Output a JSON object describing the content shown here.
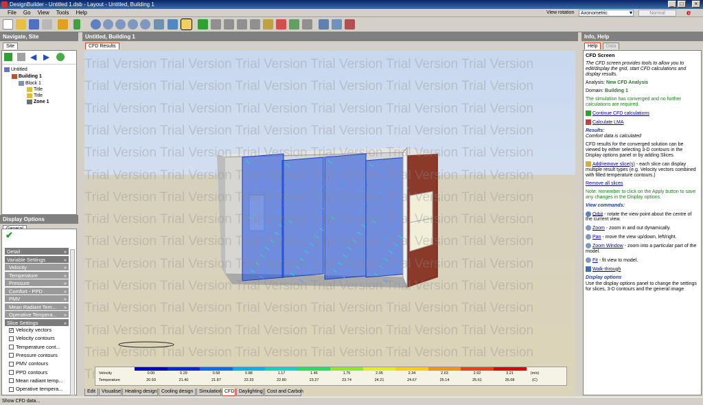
{
  "window": {
    "title": "DesignBuilder - Untitled 1.dsb - Layout - Untitled, Building 1"
  },
  "menu": [
    "File",
    "Go",
    "View",
    "Tools",
    "Help"
  ],
  "toolbar": {
    "view_rotation_label": "View rotation",
    "view_rotation_value": "Axonometric",
    "normal_label": "Normal"
  },
  "left": {
    "nav_header": "Navigate, Site",
    "nav_tab": "Site",
    "tree": [
      {
        "label": "Untitled",
        "level": 0
      },
      {
        "label": "Building 1",
        "level": 1
      },
      {
        "label": "Block 1",
        "level": 2
      },
      {
        "label": "Title",
        "level": 3
      },
      {
        "label": "Title",
        "level": 3
      },
      {
        "label": "Zone 1",
        "level": 3
      }
    ],
    "display_header": "Display Options",
    "display_tab": "General",
    "options": [
      {
        "label": "Detail",
        "type": "h"
      },
      {
        "label": "Variable Settings",
        "type": "h"
      },
      {
        "label": "Velocity",
        "type": "s"
      },
      {
        "label": "Temperature",
        "type": "s"
      },
      {
        "label": "Pressure",
        "type": "s"
      },
      {
        "label": "Comfort - PPD",
        "type": "s"
      },
      {
        "label": "PMV",
        "type": "s"
      },
      {
        "label": "Mean Radiant Tem...",
        "type": "s"
      },
      {
        "label": "Operative Tempera...",
        "type": "s"
      },
      {
        "label": "Slice Settings",
        "type": "h"
      }
    ],
    "checks": [
      {
        "label": "Velocity vectors",
        "checked": true
      },
      {
        "label": "Velocity contours",
        "checked": false
      },
      {
        "label": "Temperature cont...",
        "checked": false
      },
      {
        "label": "Pressure contours",
        "checked": false
      },
      {
        "label": "PMV contours",
        "checked": false
      },
      {
        "label": "PPD contours",
        "checked": false
      },
      {
        "label": "Mean radiant temp...",
        "checked": false
      },
      {
        "label": "Operative tempera...",
        "checked": false
      }
    ]
  },
  "center": {
    "header": "Untitled, Building 1",
    "tab": "CFD Results",
    "watermark": "Trial Version Trial Version Trial Version Trial Version Trial Version Trial Version",
    "legend": {
      "velocity_label": "Velocity",
      "temperature_label": "Temperature",
      "velocity_values": [
        "0.00",
        "0.29",
        "0.58",
        "0.88",
        "1.17",
        "1.46",
        "1.75",
        "2.05",
        "2.34",
        "2.63",
        "2.92",
        "3.21"
      ],
      "temperature_values": [
        "20.93",
        "21.40",
        "21.87",
        "22.33",
        "22.80",
        "23.27",
        "23.74",
        "24.21",
        "24.67",
        "25.14",
        "25.61",
        "26.08"
      ],
      "velocity_unit": "(m/s)",
      "temperature_unit": "(C)",
      "colors": [
        "#0000c8",
        "#0028e0",
        "#0070f0",
        "#00b0f0",
        "#00d8c0",
        "#20e060",
        "#90e820",
        "#e0f020",
        "#f8d010",
        "#f89010",
        "#f04010",
        "#d80808"
      ]
    },
    "bottom_tabs": [
      "Edit",
      "Visualise",
      "Heating design",
      "Cooling design",
      "Simulation",
      "CFD",
      "Daylighting",
      "Cost and Carbon"
    ],
    "active_tab": "CFD"
  },
  "right": {
    "header": "Info, Help",
    "tabs": [
      "Help",
      "Data"
    ],
    "title": "CFD Screen",
    "intro": "The CFD screen provides tools to allow you to edit/display the grid, start CFD calculations and display results.",
    "analysis_label": "Analysis:",
    "analysis_value": "New CFD Analysis",
    "domain_label": "Domain:",
    "domain_value": "Building 1",
    "converged": "The simulation has converged and no further calculations are required.",
    "continue_link": "Continue CFD calculations",
    "lma_link": "Calculate LMA",
    "results_heading": "Results:",
    "results_sub": "Comfort data is calculated",
    "results_text": "CFD results for the converged solution can be viewed by either selecting 3-D contours in the Display options panel or by adding Slices.",
    "slices_link": "Add/remove slice(s)",
    "slices_text": " - each slice can display multiple result types (e.g. Velocity vectors combined with filled temperature contours.)",
    "remove_link": "Remove all slices",
    "note": "Note: remember to click on the Apply button to save any changes in the Display options.",
    "view_heading": "View commands:",
    "orbit_link": "Orbit",
    "orbit_text": " - rotate the view point about the centre of the current view.",
    "zoom_link": "Zoom",
    "zoom_text": " - zoom in and out dynamically.",
    "pan_link": "Pan",
    "pan_text": " - move the view up/down, left/right.",
    "zoomwin_link": "Zoom Window",
    "zoomwin_text": " - zoom into a particular part of the model.",
    "fit_link": "Fit",
    "fit_text": " - fit view to model.",
    "walk_link": "Walk-through",
    "display_heading": "Display options",
    "display_text": "Use the display options panel to change the settings for slices, 3-D contours and the general image"
  },
  "status": "Show CFD data..."
}
